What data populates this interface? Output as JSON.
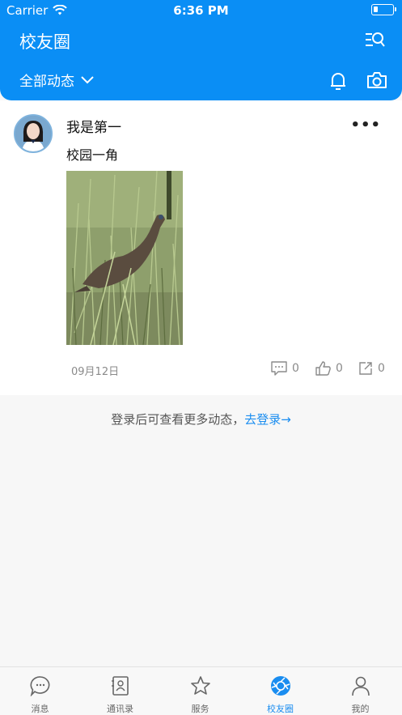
{
  "status_bar": {
    "carrier": "Carrier",
    "time": "6:36 PM"
  },
  "header": {
    "title": "校友圈",
    "filter_label": "全部动态"
  },
  "post": {
    "author": "我是第一",
    "content": "校园一角",
    "date": "09月12日",
    "comments": "0",
    "likes": "0",
    "shares": "0"
  },
  "login_hint": {
    "text": "登录后可查看更多动态，",
    "link": "去登录→"
  },
  "tabbar": {
    "items": [
      {
        "label": "消息",
        "icon": "chat-bubble-icon"
      },
      {
        "label": "通讯录",
        "icon": "contacts-icon"
      },
      {
        "label": "服务",
        "icon": "star-icon"
      },
      {
        "label": "校友圈",
        "icon": "aperture-icon"
      },
      {
        "label": "我的",
        "icon": "person-icon"
      }
    ],
    "active_index": 3
  },
  "colors": {
    "primary": "#0a8ef5",
    "link": "#1a8df0"
  }
}
